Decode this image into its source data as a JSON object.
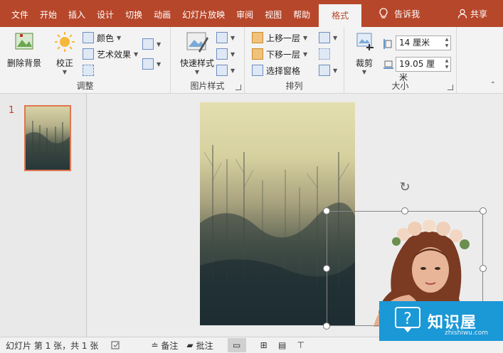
{
  "tabs": [
    "文件",
    "开始",
    "插入",
    "设计",
    "切换",
    "动画",
    "幻灯片放映",
    "审阅",
    "视图",
    "帮助",
    "格式"
  ],
  "active_tab": "格式",
  "tell_me": "告诉我",
  "share": "共享",
  "ribbon": {
    "remove_bg": "删除背景",
    "corrections": "校正",
    "color": "颜色",
    "artistic": "艺术效果",
    "adjust_label": "调整",
    "quick_styles": "快速样式",
    "picture_styles_label": "图片样式",
    "bring_forward": "上移一层",
    "send_backward": "下移一层",
    "selection_pane": "选择窗格",
    "arrange_label": "排列",
    "crop": "裁剪",
    "height_value": "14 厘米",
    "width_value": "19.05 厘米",
    "size_label": "大小"
  },
  "slides": {
    "current_number": "1"
  },
  "status": {
    "slide_info": "幻灯片 第 1 张，共 1 张",
    "notes": "备注",
    "comments": "批注"
  },
  "watermark": {
    "title": "知识屋",
    "subtitle": "zhishiwu.com"
  },
  "colors": {
    "accent": "#b7472a",
    "ribbon_bg": "#f3f3f3",
    "watermark": "#1b98d6"
  }
}
